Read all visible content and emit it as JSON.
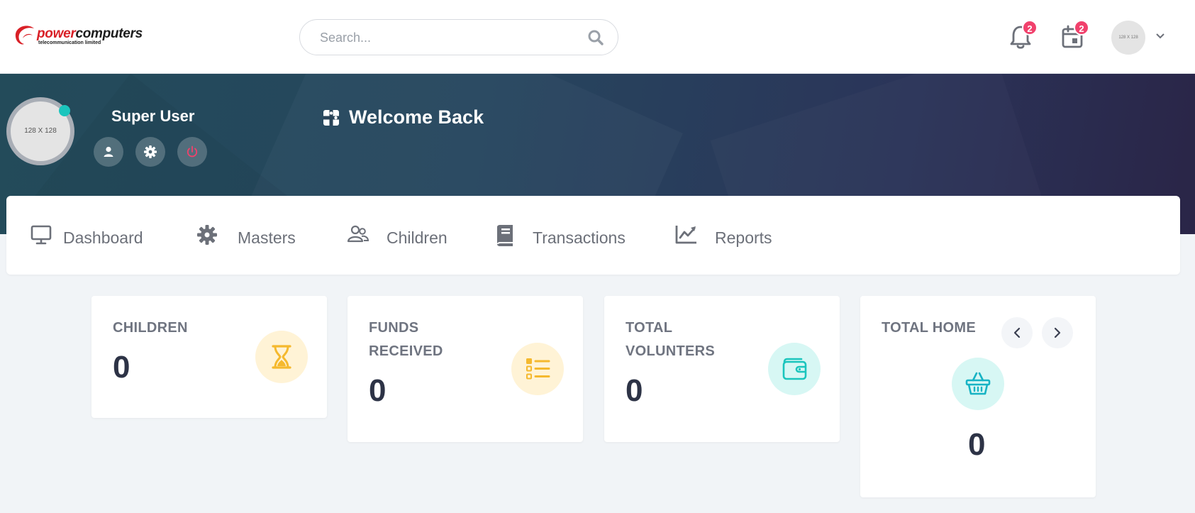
{
  "brand": {
    "name_part1": "power",
    "name_part2": "computers",
    "tagline": "telecommunication limited",
    "colors": {
      "red": "#d92027",
      "dark": "#1c1c1c"
    }
  },
  "search": {
    "placeholder": "Search...",
    "value": "",
    "icon": "search-icon"
  },
  "notifications": {
    "icon": "bell-icon",
    "count": "2"
  },
  "calendar": {
    "icon": "calendar-icon",
    "count": "2"
  },
  "header_avatar": {
    "placeholder_text": "128 X 128",
    "icon": "chevron-down-icon"
  },
  "profile": {
    "avatar_text": "128 X 128",
    "name": "Super User",
    "status_color": "#1bc5bd",
    "actions": [
      {
        "icon": "user-icon"
      },
      {
        "icon": "gear-icon"
      },
      {
        "icon": "power-icon"
      }
    ]
  },
  "welcome": {
    "icon": "puzzle-icon",
    "text": "Welcome Back"
  },
  "menu": {
    "items": [
      {
        "label": "Dashboard",
        "icon": "monitor-icon"
      },
      {
        "label": "Masters",
        "icon": "gear-icon"
      },
      {
        "label": "Children",
        "icon": "users-icon"
      },
      {
        "label": "Transactions",
        "icon": "book-icon"
      },
      {
        "label": "Reports",
        "icon": "chart-line-icon"
      }
    ]
  },
  "stats": {
    "children": {
      "label": "CHILDREN",
      "value": "0",
      "icon": "hourglass-icon",
      "color": "#f5b92e"
    },
    "funds": {
      "label_line1": "FUNDS",
      "label_line2": "RECEIVED",
      "value": "0",
      "icon": "list-icon",
      "color": "#f5b92e"
    },
    "volunters": {
      "label_line1": "TOTAL",
      "label_line2": "VOLUNTERS",
      "value": "0",
      "icon": "wallet-icon",
      "color": "#1bc5bd"
    },
    "home": {
      "label": "TOTAL HOME",
      "value": "0",
      "icon": "basket-icon",
      "color": "#17b3c4"
    }
  }
}
